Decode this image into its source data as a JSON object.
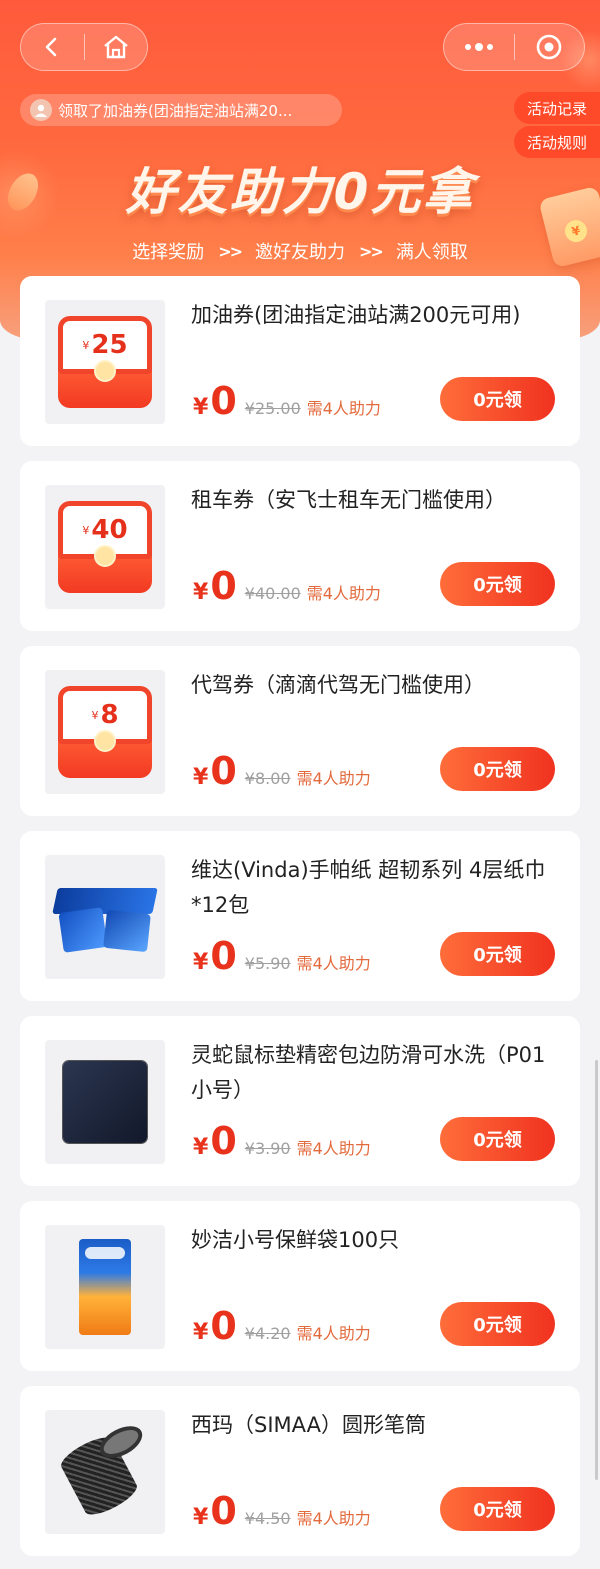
{
  "nav": {
    "back_icon": "back-arrow-icon",
    "home_icon": "home-icon",
    "more_icon": "more-dots-icon",
    "target_icon": "target-close-icon"
  },
  "ticker": {
    "text": "领取了加油券(团油指定油站满20..."
  },
  "side_buttons": {
    "records": "活动记录",
    "rules": "活动规则"
  },
  "hero": {
    "title": "好友助力0元拿",
    "steps": [
      "选择奖励",
      "邀好友助力",
      "满人领取"
    ],
    "arrow": ">>"
  },
  "currency": "¥",
  "products": [
    {
      "title": "加油券(团油指定油站满200元可用)",
      "price": "0",
      "original": "¥25.00",
      "need": "需4人助力",
      "button": "0元领",
      "thumb": "packet",
      "packet_value": "25"
    },
    {
      "title": "租车券（安飞士租车无门槛使用）",
      "price": "0",
      "original": "¥40.00",
      "need": "需4人助力",
      "button": "0元领",
      "thumb": "packet",
      "packet_value": "40"
    },
    {
      "title": "代驾券（滴滴代驾无门槛使用）",
      "price": "0",
      "original": "¥8.00",
      "need": "需4人助力",
      "button": "0元领",
      "thumb": "packet",
      "packet_value": "8"
    },
    {
      "title": "维达(Vinda)手帕纸 超韧系列 4层纸巾*12包",
      "price": "0",
      "original": "¥5.90",
      "need": "需4人助力",
      "button": "0元领",
      "thumb": "tissue"
    },
    {
      "title": "灵蛇鼠标垫精密包边防滑可水洗（P01小号）",
      "price": "0",
      "original": "¥3.90",
      "need": "需4人助力",
      "button": "0元领",
      "thumb": "mousepad"
    },
    {
      "title": "妙洁小号保鲜袋100只",
      "price": "0",
      "original": "¥4.20",
      "need": "需4人助力",
      "button": "0元领",
      "thumb": "bag"
    },
    {
      "title": "西玛（SIMAA）圆形笔筒",
      "price": "0",
      "original": "¥4.50",
      "need": "需4人助力",
      "button": "0元领",
      "thumb": "penholder"
    }
  ],
  "colors": {
    "accent": "#f0321f",
    "header": "#ff5a3c",
    "price": "#e8321c"
  }
}
